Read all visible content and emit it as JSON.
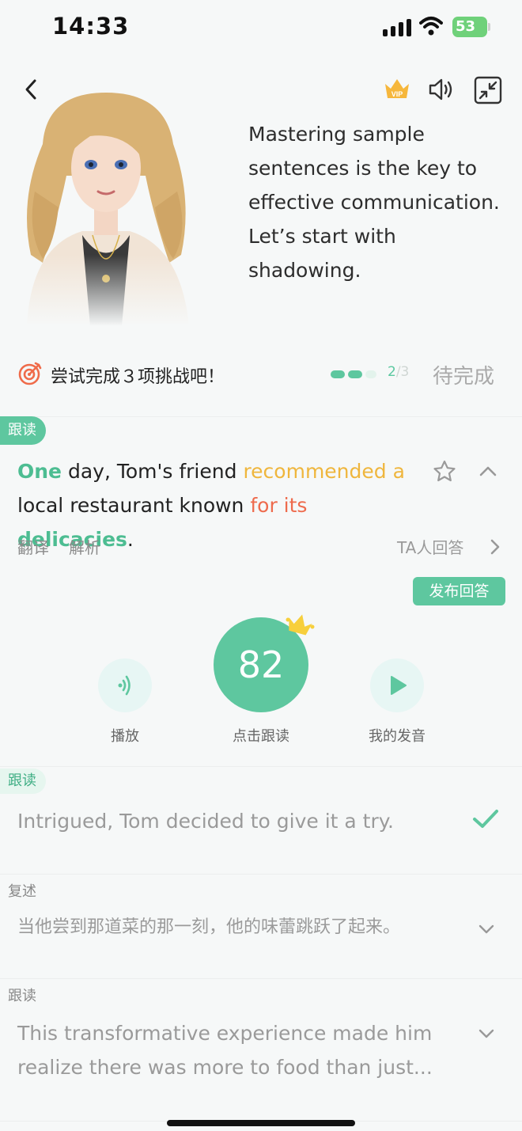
{
  "status_bar": {
    "time": "14:33",
    "battery": "53"
  },
  "intro": {
    "text": "Mastering sample sentences is the key to effective communication. Let’s start with shadowing."
  },
  "challenge": {
    "text": "尝试完成３项挑战吧！",
    "progress_current": "2",
    "progress_total": "/3",
    "status": "待完成"
  },
  "current_item": {
    "tag": "跟读",
    "sentence_parts": [
      {
        "text": "One",
        "style": "green"
      },
      {
        "text": " day, Tom's friend ",
        "style": "plain"
      },
      {
        "text": "recommended a",
        "style": "yellow"
      },
      {
        "text": " local restaurant known ",
        "style": "plain"
      },
      {
        "text": "for its",
        "style": "red"
      },
      {
        "text": " ",
        "style": "plain"
      },
      {
        "text": "delicacies",
        "style": "green"
      },
      {
        "text": ".",
        "style": "plain"
      }
    ],
    "translate_label": "翻译",
    "analysis_label": "解析",
    "others_label": "TA人回答",
    "publish_label": "发布回答",
    "play_label": "播放",
    "score": "82",
    "score_label": "点击跟读",
    "my_voice_label": "我的发音"
  },
  "items": [
    {
      "tag": "跟读",
      "text": "Intrigued, Tom decided to give it a try."
    },
    {
      "tag": "复述",
      "text": "当他尝到那道菜的那一刻，他的味蕾跳跃了起来。"
    },
    {
      "tag": "跟读",
      "text": "This transformative experience made him realize there was more to food than just..."
    }
  ],
  "colors": {
    "accent": "#5ec79f",
    "highlight_yellow": "#efb63d",
    "highlight_red": "#ee6b4d"
  }
}
